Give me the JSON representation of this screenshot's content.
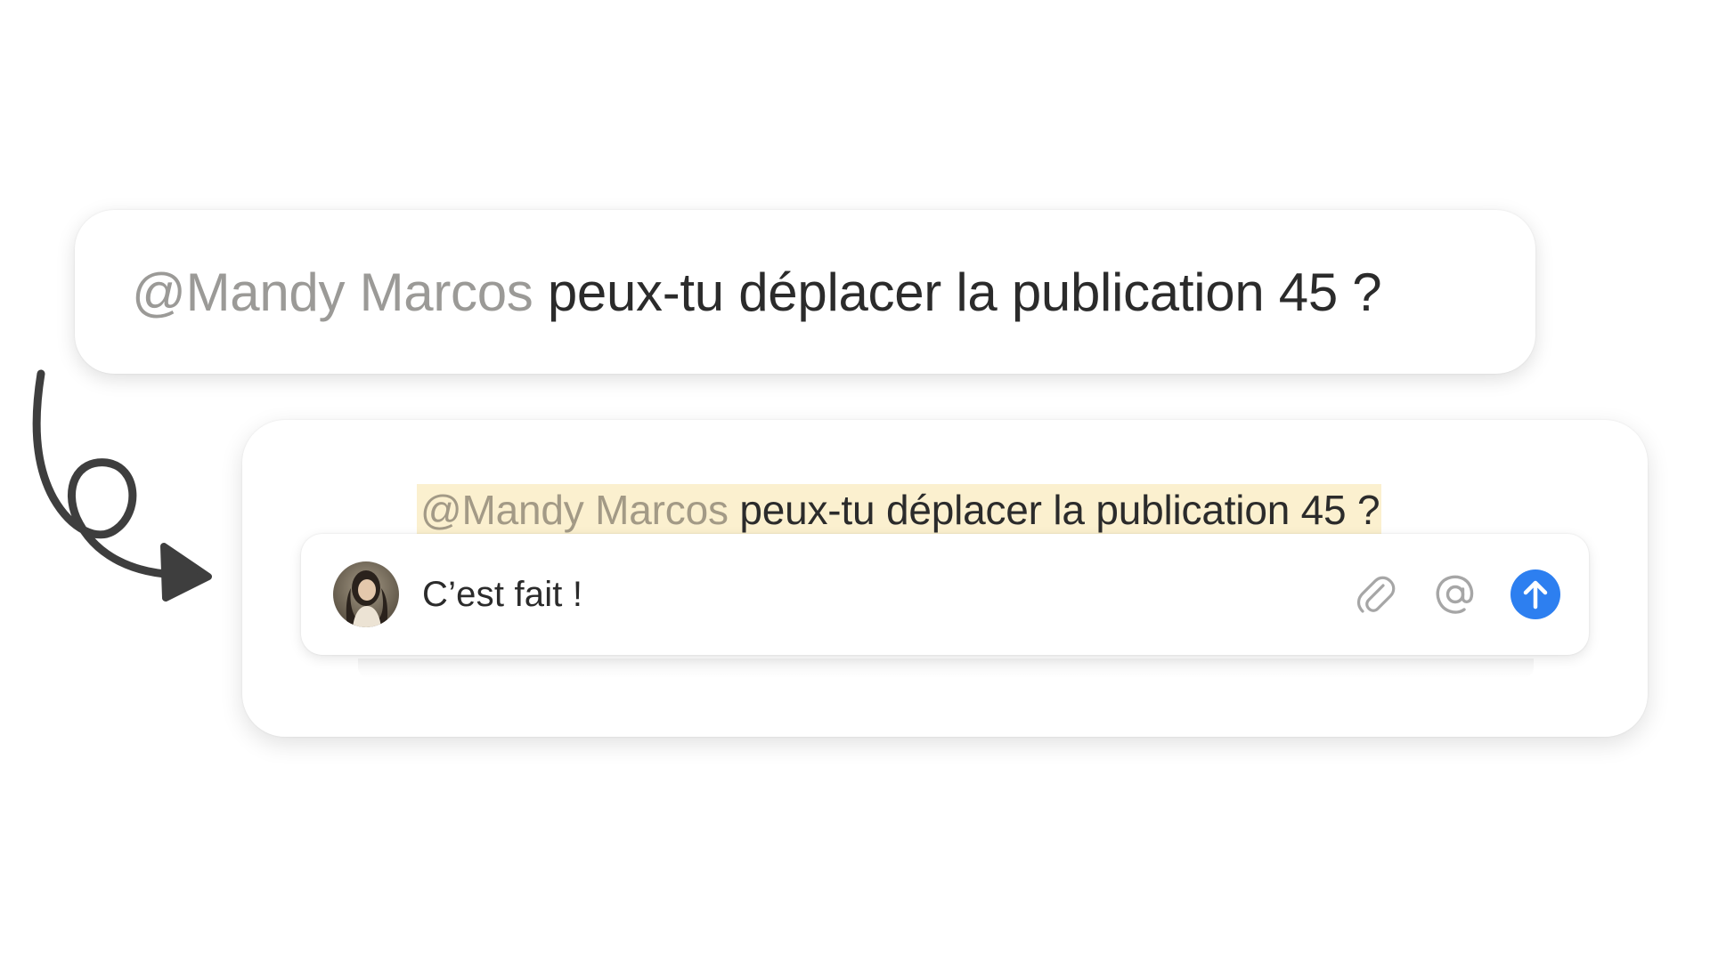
{
  "comment": {
    "mention": "@Mandy Marcos",
    "text": " peux-tu déplacer la publication 45 ?"
  },
  "reply_panel": {
    "quoted_mention": "@Mandy Marcos",
    "quoted_text": " peux-tu déplacer la publication 45 ?",
    "reply_value": "C’est fait !",
    "highlight_color": "#fbf0cf"
  },
  "icons": {
    "attach": "paperclip-icon",
    "mention": "at-sign-icon",
    "send": "arrow-up-icon",
    "decorative_arrow": "curly-arrow-icon"
  },
  "colors": {
    "send_button": "#2d7ff0",
    "mention_text": "#9b9a97",
    "icon_gray": "#a6a6a6"
  }
}
